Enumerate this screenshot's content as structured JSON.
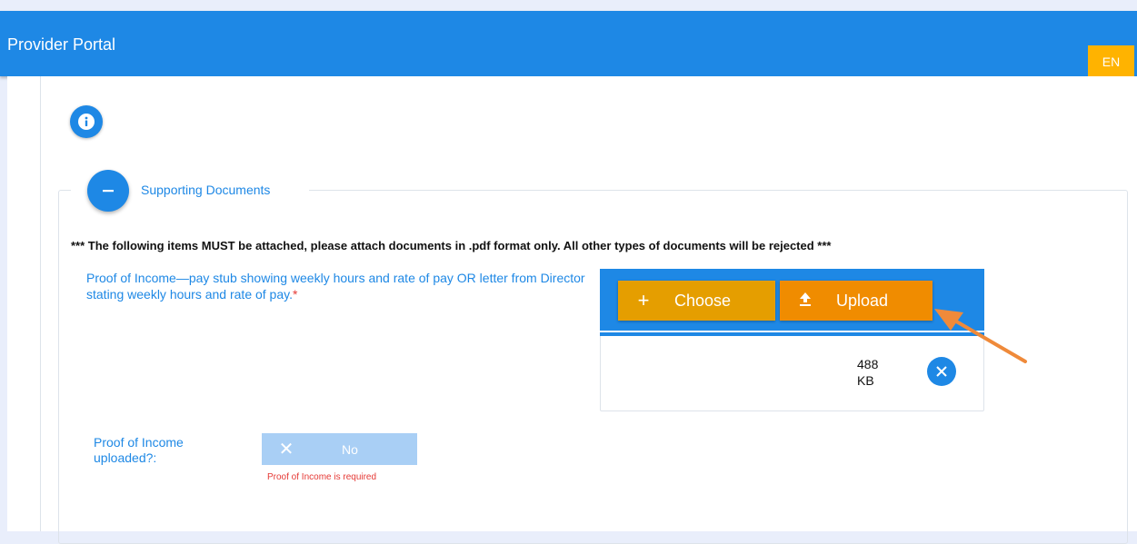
{
  "header": {
    "title": "Provider Portal",
    "language": "EN"
  },
  "section": {
    "title": "Supporting Documents",
    "notice": "*** The following items MUST be attached, please attach documents in .pdf format only. All other types of documents will be rejected ***"
  },
  "proof_income": {
    "label": "Proof of Income—pay stub showing weekly hours and rate of pay OR letter from Director stating weekly hours and rate of pay.",
    "required_marker": "*",
    "choose_label": "Choose",
    "upload_label": "Upload",
    "file_size_value": "488",
    "file_size_unit": "KB"
  },
  "uploaded_question": {
    "label": "Proof of Income uploaded?:",
    "value": "No",
    "error": "Proof of Income is required"
  },
  "colors": {
    "primary": "#1e88e5",
    "accent": "#ffb300",
    "upload": "#f08c00",
    "error": "#e53935"
  },
  "icons": [
    "info-icon",
    "minus-icon",
    "plus-icon",
    "upload-icon",
    "close-icon",
    "x-icon",
    "annotation-arrow"
  ]
}
